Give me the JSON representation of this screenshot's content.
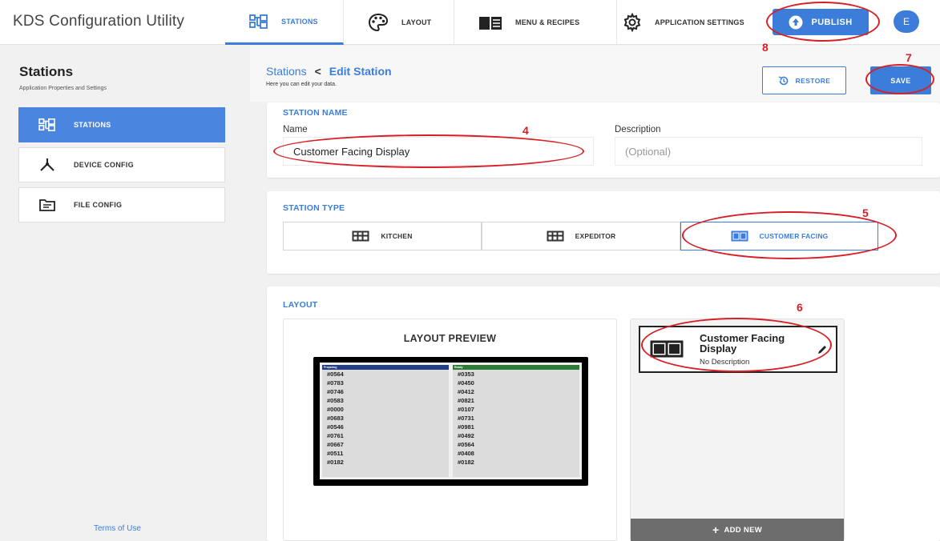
{
  "app": {
    "title": "KDS Configuration Utility"
  },
  "nav": {
    "tabs": [
      {
        "label": "STATIONS",
        "icon": "stations-icon"
      },
      {
        "label": "LAYOUT",
        "icon": "palette-icon"
      },
      {
        "label": "MENU & RECIPES",
        "icon": "menu-book-icon"
      },
      {
        "label": "APPLICATION SETTINGS",
        "icon": "gear-icon"
      }
    ],
    "publish_label": "PUBLISH",
    "avatar_initial": "E"
  },
  "sidebar": {
    "title": "Stations",
    "subtitle": "Application Properties and Settings",
    "items": [
      {
        "label": "STATIONS",
        "icon": "stations-icon"
      },
      {
        "label": "DEVICE CONFIG",
        "icon": "device-tree-icon"
      },
      {
        "label": "FILE CONFIG",
        "icon": "folder-icon"
      }
    ],
    "terms_label": "Terms of Use"
  },
  "header": {
    "breadcrumb_root": "Stations",
    "breadcrumb_separator": "<",
    "breadcrumb_current": "Edit Station",
    "subtitle": "Here you can edit your data.",
    "restore_label": "RESTORE",
    "save_label": "SAVE"
  },
  "station_name": {
    "section_title": "STATION NAME",
    "name_label": "Name",
    "name_value": "Customer Facing Display",
    "description_label": "Description",
    "description_placeholder": "(Optional)"
  },
  "station_type": {
    "section_title": "STATION TYPE",
    "options": [
      "KITCHEN",
      "EXPEDITOR",
      "CUSTOMER FACING"
    ],
    "selected": "CUSTOMER FACING"
  },
  "layout": {
    "section_title": "LAYOUT",
    "preview_title": "LAYOUT PREVIEW",
    "preview": {
      "left_header": "Preparing",
      "right_header": "Ready",
      "left_color": "#243c82",
      "right_color": "#2c7a34",
      "left_orders": [
        "#0564",
        "#0783",
        "#0746",
        "#0583",
        "#0000",
        "#0683",
        "#0546",
        "#0761",
        "#0667",
        "#0511",
        "#0182"
      ],
      "right_orders": [
        "#0353",
        "#0450",
        "#0412",
        "#0821",
        "#0107",
        "#0731",
        "#0981",
        "#0492",
        "#0564",
        "#0408",
        "#0182"
      ]
    },
    "tile": {
      "name": "Customer Facing Display",
      "description": "No Description"
    },
    "add_new_label": "ADD NEW"
  },
  "annotations": {
    "color": "#d81f26",
    "labels": [
      "4",
      "5",
      "6",
      "7",
      "8"
    ]
  },
  "colors": {
    "accent": "#3b7dd8",
    "sidebar_active": "#4a86e0"
  }
}
